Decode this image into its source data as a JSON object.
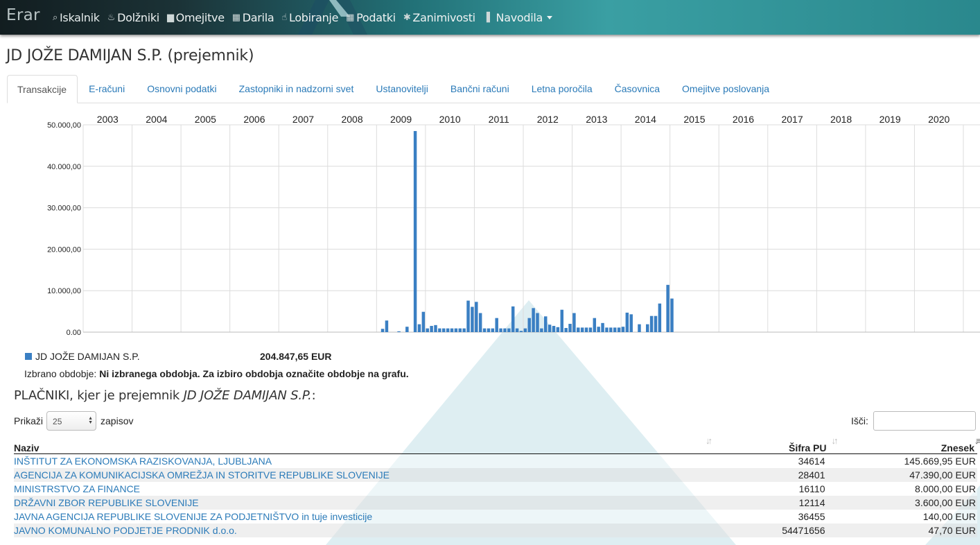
{
  "navbar": {
    "brand": "Erar",
    "items": [
      {
        "label": "Iskalnik",
        "icon": "search-icon",
        "glyph": "⌕"
      },
      {
        "label": "Dolžniki",
        "icon": "fire-icon",
        "glyph": "♨"
      },
      {
        "label": "Omejitve",
        "icon": "briefcase-icon",
        "glyph": "▆"
      },
      {
        "label": "Darila",
        "icon": "gift-icon",
        "glyph": "▦"
      },
      {
        "label": "Lobiranje",
        "icon": "hand-icon",
        "glyph": "☝"
      },
      {
        "label": "Podatki",
        "icon": "grid-icon",
        "glyph": "▦"
      },
      {
        "label": "Zanimivosti",
        "icon": "asterisk-icon",
        "glyph": "✱"
      },
      {
        "label": "Navodila",
        "icon": "book-icon",
        "glyph": "▐"
      }
    ]
  },
  "page": {
    "title": "JD JOŽE DAMIJAN S.P. (prejemnik)"
  },
  "tabs": [
    {
      "label": "Transakcije",
      "active": true
    },
    {
      "label": "E-računi"
    },
    {
      "label": "Osnovni podatki"
    },
    {
      "label": "Zastopniki in nadzorni svet"
    },
    {
      "label": "Ustanovitelji"
    },
    {
      "label": "Bančni računi"
    },
    {
      "label": "Letna poročila"
    },
    {
      "label": "Časovnica"
    },
    {
      "label": "Omejitve poslovanja"
    }
  ],
  "chart_data": {
    "type": "bar",
    "title": "",
    "xlabel": "",
    "ylabel": "",
    "x_ticks": [
      "2003",
      "2004",
      "2005",
      "2006",
      "2007",
      "2008",
      "2009",
      "2010",
      "2011",
      "2012",
      "2013",
      "2014",
      "2015",
      "2016",
      "2017",
      "2018",
      "2019",
      "2020"
    ],
    "y_ticks": [
      "0.00",
      "10.000,00",
      "20.000,00",
      "30.000,00",
      "40.000,00",
      "50.000,00"
    ],
    "ylim": [
      0,
      50000
    ],
    "grid": true,
    "bar_color": "#3a7fc3",
    "series": [
      {
        "name": "JD JOŽE DAMIJAN S.P.",
        "x": [
          "2009-02",
          "2009-03",
          "2009-06",
          "2009-08",
          "2009-10",
          "2009-11",
          "2009-12",
          "2010-01",
          "2010-02",
          "2010-03",
          "2010-04",
          "2010-05",
          "2010-06",
          "2010-07",
          "2010-08",
          "2010-09",
          "2010-10",
          "2010-11",
          "2010-12",
          "2011-01",
          "2011-02",
          "2011-03",
          "2011-04",
          "2011-05",
          "2011-06",
          "2011-07",
          "2011-08",
          "2011-09",
          "2011-10",
          "2011-11",
          "2011-12",
          "2012-01",
          "2012-02",
          "2012-03",
          "2012-04",
          "2012-05",
          "2012-06",
          "2012-07",
          "2012-08",
          "2012-09",
          "2012-10",
          "2012-11",
          "2012-12",
          "2013-01",
          "2013-02",
          "2013-03",
          "2013-04",
          "2013-05",
          "2013-06",
          "2013-07",
          "2013-08",
          "2013-09",
          "2013-10",
          "2013-11",
          "2013-12",
          "2014-01",
          "2014-02",
          "2014-03",
          "2014-05",
          "2014-07",
          "2014-08",
          "2014-09",
          "2014-10",
          "2014-12",
          "2015-01"
        ],
        "values": [
          800,
          2800,
          200,
          1300,
          48500,
          1900,
          4900,
          900,
          1500,
          1700,
          900,
          900,
          900,
          900,
          900,
          900,
          900,
          7600,
          6100,
          7300,
          4600,
          900,
          900,
          900,
          3400,
          900,
          900,
          900,
          6200,
          900,
          300,
          900,
          3400,
          5800,
          4600,
          900,
          3800,
          1800,
          1500,
          1200,
          5400,
          1000,
          2000,
          4600,
          1100,
          1100,
          1100,
          1100,
          3400,
          1300,
          2200,
          1100,
          1100,
          1100,
          1100,
          1300,
          4700,
          4300,
          1900,
          1900,
          3900,
          3900,
          6900,
          11400,
          8100
        ]
      }
    ]
  },
  "legend": {
    "series_name": "JD JOŽE DAMIJAN S.P.",
    "total": "204.847,65 EUR"
  },
  "period": {
    "label": "Izbrano obdobje:",
    "value": "Ni izbranega obdobja. Za izbiro obdobja označite obdobje na grafu."
  },
  "payers": {
    "title_prefix": "PLAČNIKI, kjer je prejemnik",
    "title_name": "JD JOŽE DAMIJAN S.P.",
    "title_suffix": ":",
    "show_label": "Prikaži",
    "show_value": "25",
    "show_suffix": "zapisov",
    "search_label": "Išči:",
    "search_value": "",
    "columns": {
      "name": "Naziv",
      "code": "Šifra PU",
      "amount": "Znesek"
    },
    "rows": [
      {
        "name": "INŠTITUT ZA EKONOMSKA RAZISKOVANJA, LJUBLJANA",
        "code": "34614",
        "amount": "145.669,95 EUR"
      },
      {
        "name": "AGENCIJA ZA KOMUNIKACIJSKA OMREŽJA IN STORITVE REPUBLIKE SLOVENIJE",
        "code": "28401",
        "amount": "47.390,00 EUR"
      },
      {
        "name": "MINISTRSTVO ZA FINANCE",
        "code": "16110",
        "amount": "8.000,00 EUR"
      },
      {
        "name": "DRŽAVNI ZBOR REPUBLIKE SLOVENIJE",
        "code": "12114",
        "amount": "3.600,00 EUR"
      },
      {
        "name": "JAVNA AGENCIJA REPUBLIKE SLOVENIJE ZA PODJETNIŠTVO in tuje investicije",
        "code": "36455",
        "amount": "140,00 EUR"
      },
      {
        "name": "JAVNO KOMUNALNO PODJETJE PRODNIK d.o.o.",
        "code": "54471656",
        "amount": "47,70 EUR"
      }
    ]
  },
  "colors": {
    "link": "#2a7ab8",
    "bar": "#3a7fc3",
    "navbar_dark": "#121d20",
    "navbar_teal": "#3a9fa3",
    "triangle": "#d8ebf0"
  }
}
